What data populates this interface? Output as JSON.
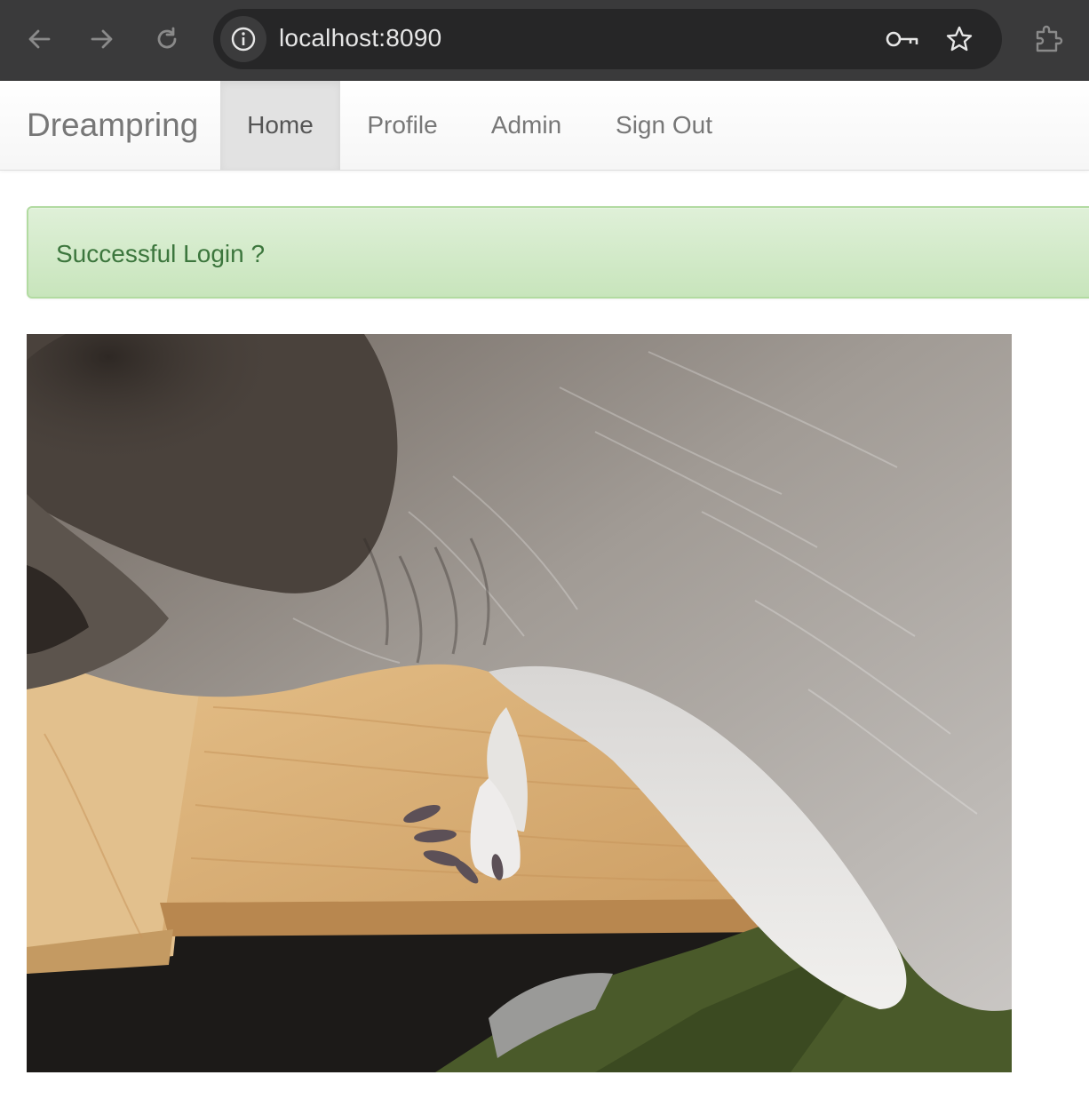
{
  "browser": {
    "url": "localhost:8090",
    "icons": [
      "back-arrow-icon",
      "forward-arrow-icon",
      "reload-icon",
      "site-info-icon",
      "key-icon",
      "star-icon",
      "extensions-icon"
    ]
  },
  "navbar": {
    "brand": "Dreampring",
    "items": [
      {
        "label": "Home",
        "active": true
      },
      {
        "label": "Profile",
        "active": false
      },
      {
        "label": "Admin",
        "active": false
      },
      {
        "label": "Sign Out",
        "active": false
      }
    ]
  },
  "alert": {
    "message": "Successful Login ?",
    "color": "#3c763d",
    "background": "#dff0d8"
  },
  "photo": {
    "subject": "raccoon-photo"
  }
}
